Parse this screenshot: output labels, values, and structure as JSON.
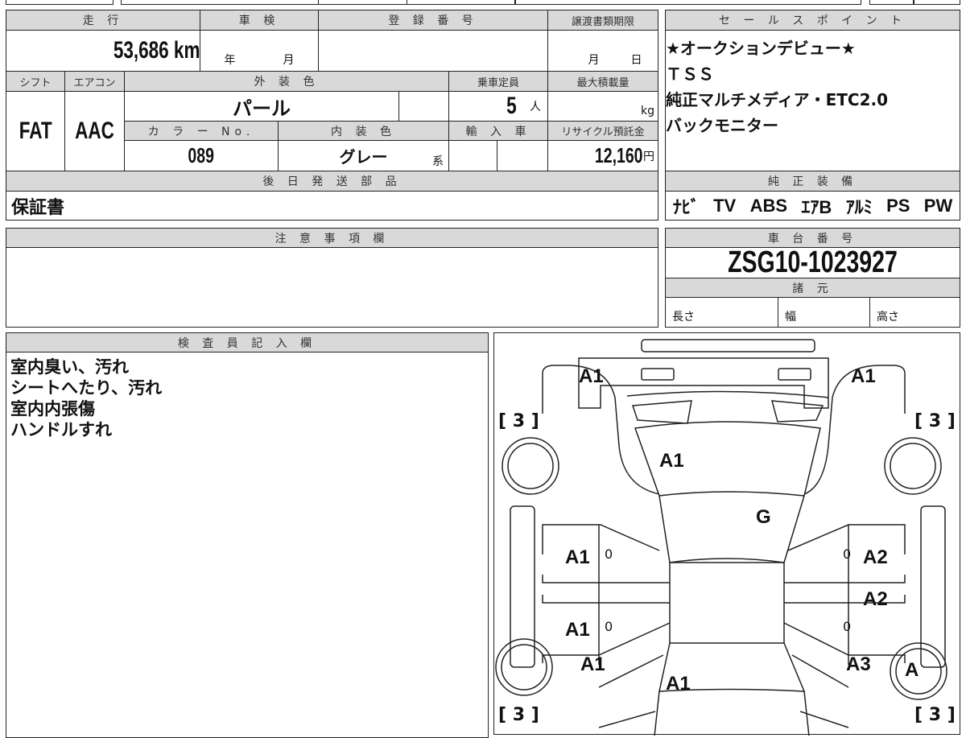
{
  "mileage": {
    "label": "走 行",
    "value": "53,686 km"
  },
  "inspection": {
    "label": "車 検",
    "year": "年",
    "month": "月"
  },
  "registration": {
    "label": "登 録 番 号"
  },
  "transfer_deadline": {
    "label": "譲渡書類期限",
    "month": "月",
    "day": "日"
  },
  "shift": {
    "label": "シフト",
    "value": "FAT"
  },
  "aircon": {
    "label": "エアコン",
    "value": "AAC"
  },
  "exterior_color": {
    "label": "外 装 色",
    "value": "パール"
  },
  "capacity": {
    "label": "乗車定員",
    "value": "5",
    "unit": "人"
  },
  "max_load": {
    "label": "最大積載量",
    "unit": "kg"
  },
  "color_no": {
    "label": "カ ラ ー No.",
    "value": "089"
  },
  "interior_color": {
    "label": "内 装 色",
    "value": "グレー",
    "suffix": "系"
  },
  "import": {
    "label": "輸 入 車"
  },
  "recycle": {
    "label": "リサイクル預託金",
    "value": "12,160",
    "unit": "円"
  },
  "later_parts": {
    "label": "後 日 発 送 部 品",
    "value": "保証書"
  },
  "sales_points": {
    "label": "セ ー ル ス ポ イ ン ト",
    "items": [
      "★オークションデビュー★",
      "ＴＳＳ",
      "純正マルチメディア・ETC2.0",
      "バックモニター"
    ]
  },
  "equipment": {
    "label": "純 正 装 備",
    "items": [
      "ﾅﾋﾞ",
      "TV",
      "ABS",
      "ｴｱB",
      "ｱﾙﾐ",
      "PS",
      "PW"
    ]
  },
  "notes": {
    "label": "注 意 事 項 欄"
  },
  "chassis": {
    "label": "車 台 番 号",
    "value": "ZSG10-1023927"
  },
  "specs": {
    "label": "諸 元",
    "length": "長さ",
    "width": "幅",
    "height": "高さ"
  },
  "inspector": {
    "label": "検 査 員 記 入 欄",
    "lines": [
      "室内臭い、汚れ",
      "シートへたり、汚れ",
      "室内内張傷",
      "ハンドルすれ"
    ]
  },
  "diagram": {
    "marks": {
      "front_left": "A1",
      "front_right": "A1",
      "hood": "A1",
      "windshield": "G",
      "fl_door": "A1",
      "rl_door": "A1",
      "fr_door": "A2",
      "rr_door": "A2",
      "rl_quarter": "A1",
      "rr_quarter": "A3",
      "trunk": "A1",
      "rr_wheel": "A"
    },
    "tread": {
      "fl": "3",
      "fr": "3",
      "rl": "3",
      "rr": "3"
    },
    "zero": "0"
  }
}
